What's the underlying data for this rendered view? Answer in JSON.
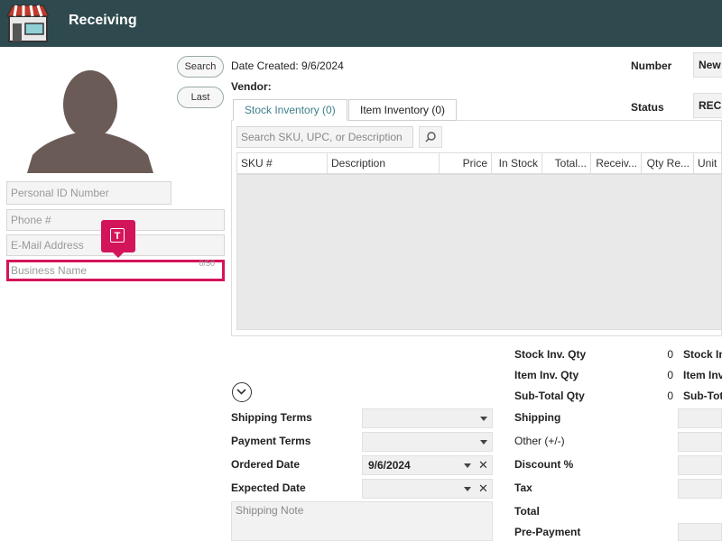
{
  "header": {
    "title": "Receiving"
  },
  "left": {
    "search_label": "Search",
    "last_label": "Last",
    "personal_id_placeholder": "Personal ID Number",
    "phone_placeholder": "Phone #",
    "email_placeholder": "E-Mail Address",
    "business_placeholder": "Business Name",
    "business_counter": "0/50",
    "tooltip_icon": "T"
  },
  "info": {
    "date_created": "Date Created: 9/6/2024",
    "vendor_label": "Vendor:",
    "number_label": "Number",
    "number_value": "New",
    "status_label": "Status",
    "status_value": "RECI"
  },
  "tabs": [
    {
      "label": "Stock Inventory (0)"
    },
    {
      "label": "Item Inventory (0)"
    }
  ],
  "search": {
    "placeholder": "Search SKU, UPC, or Description"
  },
  "grid": {
    "columns": [
      "SKU #",
      "Description",
      "Price",
      "In Stock",
      "Total...",
      "Receiv...",
      "Qty Re...",
      "Unit"
    ]
  },
  "summary": {
    "stock_inv_qty_label": "Stock Inv. Qty",
    "stock_inv_qty": "0",
    "item_inv_qty_label": "Item Inv. Qty",
    "item_inv_qty": "0",
    "subtotal_qty_label": "Sub-Total Qty",
    "subtotal_qty": "0",
    "stock_inv_right": "Stock In",
    "item_inv_right": "Item Inv",
    "subtotal_right": "Sub-Tot",
    "shipping_label": "Shipping",
    "other_label": "Other (+/-)",
    "discount_label": "Discount %",
    "tax_label": "Tax",
    "total_label": "Total",
    "prepayment_label": "Pre-Payment"
  },
  "terms": {
    "shipping_terms_label": "Shipping Terms",
    "payment_terms_label": "Payment Terms",
    "ordered_date_label": "Ordered Date",
    "ordered_date_value": "9/6/2024",
    "expected_date_label": "Expected Date",
    "shipping_note_placeholder": "Shipping Note"
  },
  "colors": {
    "header_bg": "#2f4a4f",
    "accent": "#d4145a",
    "tab_active": "#3e7f8a"
  }
}
